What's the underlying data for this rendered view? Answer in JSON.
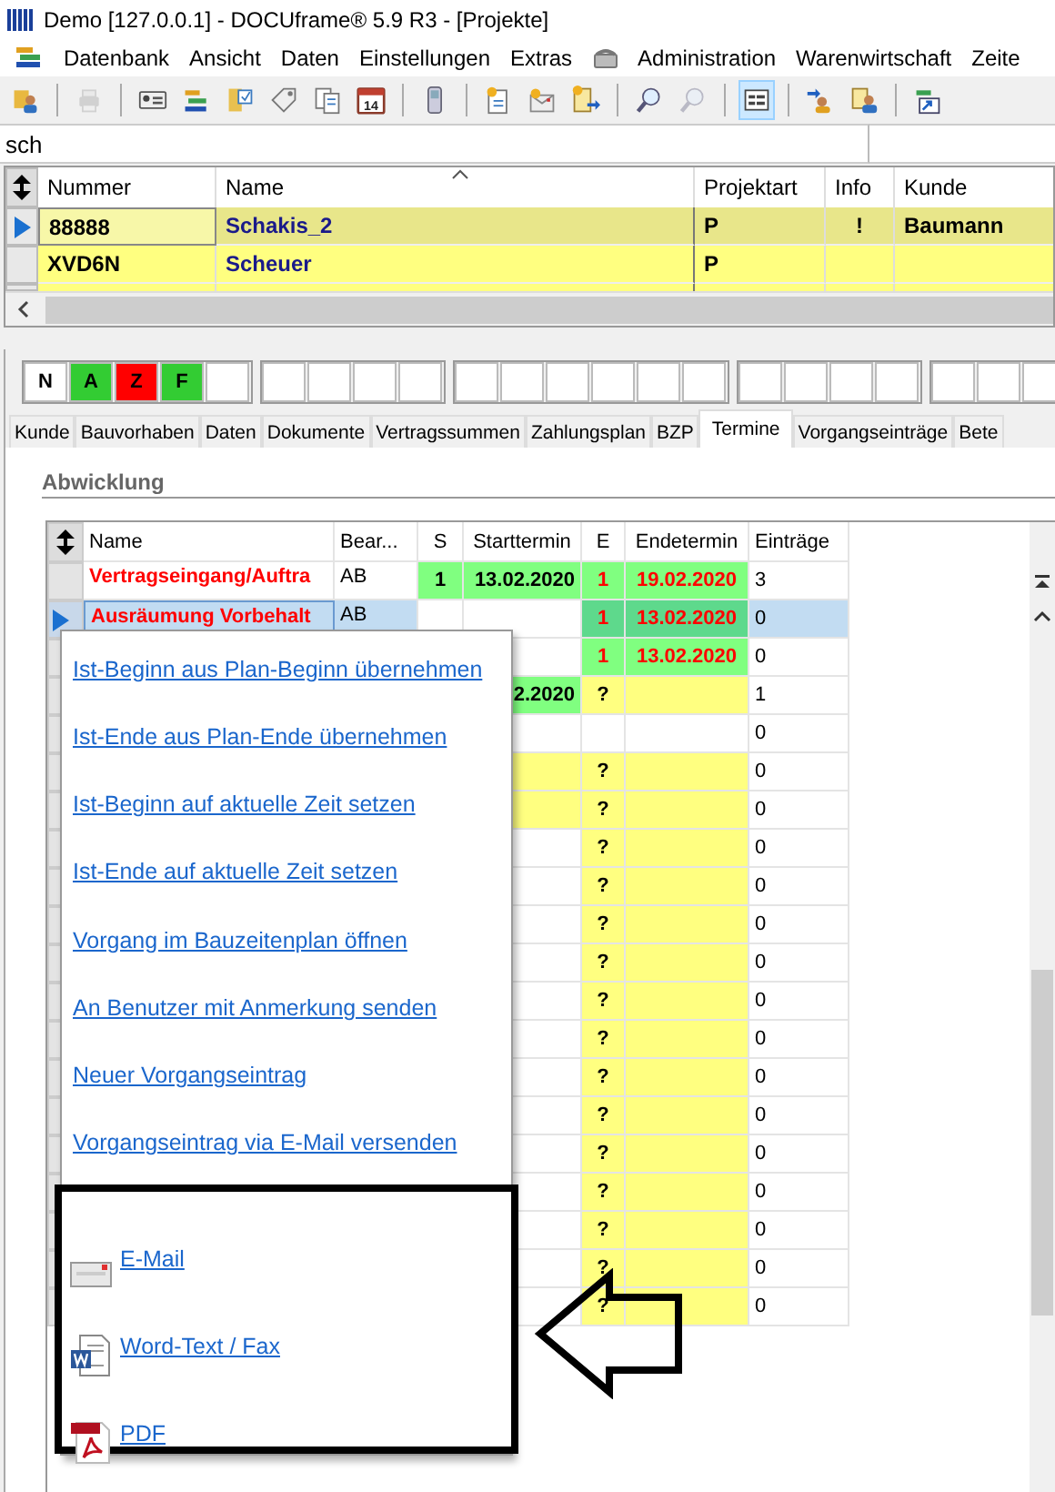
{
  "window": {
    "title": "Demo [127.0.0.1] - DOCUframe® 5.9 R3 - [Projekte]"
  },
  "menu": [
    {
      "label": "Datenbank",
      "kind": "text"
    },
    {
      "label": "Ansicht",
      "kind": "text"
    },
    {
      "label": "Daten",
      "kind": "text"
    },
    {
      "label": "Einstellungen",
      "kind": "text"
    },
    {
      "label": "Extras",
      "kind": "text"
    },
    {
      "label": "Administration",
      "kind": "phone"
    },
    {
      "label": "Warenwirtschaft",
      "kind": "text"
    },
    {
      "label": "Zeite",
      "kind": "text"
    }
  ],
  "toolbar": [
    [
      {
        "kind": "people",
        "disabled": false,
        "selected": false
      }
    ],
    [
      {
        "kind": "printer",
        "disabled": true,
        "selected": false
      }
    ],
    [
      {
        "kind": "card",
        "disabled": false,
        "selected": false
      },
      {
        "kind": "bars",
        "disabled": false,
        "selected": false
      },
      {
        "kind": "folder",
        "disabled": false,
        "selected": false
      },
      {
        "kind": "tag",
        "disabled": false,
        "selected": false
      },
      {
        "kind": "docs",
        "disabled": false,
        "selected": false
      },
      {
        "kind": "calendar",
        "label": "14",
        "disabled": false,
        "selected": false
      }
    ],
    [
      {
        "kind": "phone",
        "disabled": false,
        "selected": false
      }
    ],
    [
      {
        "kind": "docnew",
        "disabled": false,
        "selected": false
      },
      {
        "kind": "mailnew",
        "disabled": false,
        "selected": false
      },
      {
        "kind": "docarrow",
        "disabled": false,
        "selected": false
      }
    ],
    [
      {
        "kind": "search",
        "disabled": false,
        "selected": false
      },
      {
        "kind": "search",
        "disabled": true,
        "selected": false
      }
    ],
    [
      {
        "kind": "form",
        "disabled": false,
        "selected": true
      }
    ],
    [
      {
        "kind": "peoplearrow",
        "disabled": false,
        "selected": false
      },
      {
        "kind": "peopledoc",
        "disabled": false,
        "selected": false
      }
    ],
    [
      {
        "kind": "shortcut",
        "disabled": false,
        "selected": false
      }
    ]
  ],
  "search": {
    "value": "sch"
  },
  "projects": {
    "columns": [
      "Nummer",
      "Name",
      "Projektart",
      "Info",
      "Kunde"
    ],
    "rows": [
      {
        "number": "88888",
        "name": "Schakis_2",
        "type": "P",
        "info": "!",
        "customer": "Baumann",
        "selected": true
      },
      {
        "number": "XVD6N",
        "name": "Scheuer",
        "type": "P",
        "selected": false
      }
    ]
  },
  "status_groups": [
    [
      {
        "label": "N",
        "color": "#ffffff"
      },
      {
        "label": "A",
        "color": "#33cc33"
      },
      {
        "label": "Z",
        "color": "#ff0000"
      },
      {
        "label": "F",
        "color": "#33cc33"
      },
      {
        "color": "#ffffff"
      }
    ],
    [
      {
        "color": "#ffffff"
      },
      {
        "color": "#ffffff"
      },
      {
        "color": "#ffffff"
      },
      {
        "color": "#ffffff"
      }
    ],
    [
      {
        "color": "#ffffff"
      },
      {
        "color": "#ffffff"
      },
      {
        "color": "#ffffff"
      },
      {
        "color": "#ffffff"
      },
      {
        "color": "#ffffff"
      },
      {
        "color": "#ffffff"
      }
    ],
    [
      {
        "color": "#ffffff"
      },
      {
        "color": "#ffffff"
      },
      {
        "color": "#ffffff"
      },
      {
        "color": "#ffffff"
      }
    ],
    [
      {
        "color": "#ffffff"
      },
      {
        "color": "#ffffff"
      },
      {
        "color": "#ffffff"
      }
    ]
  ],
  "tabs": [
    {
      "label": "Kunde",
      "selected": false
    },
    {
      "label": "Bauvorhaben",
      "selected": false
    },
    {
      "label": "Daten",
      "selected": false
    },
    {
      "label": "Dokumente",
      "selected": false
    },
    {
      "label": "Vertragssummen",
      "selected": false
    },
    {
      "label": "Zahlungsplan",
      "selected": false
    },
    {
      "label": "BZP",
      "selected": false
    },
    {
      "label": "Termine",
      "selected": true
    },
    {
      "label": "Vorgangseinträge",
      "selected": false
    },
    {
      "label": "Bete",
      "selected": false
    }
  ],
  "section": "Abwicklung",
  "schedule": {
    "columns": [
      "Name",
      "Bear...",
      "S",
      "Starttermin",
      "E",
      "Endetermin",
      "Einträge"
    ],
    "rows": [
      {
        "name": "Vertragseingang/Auftra",
        "worker": "AB",
        "s": "1",
        "start": {
          "text": "13.02.2020",
          "color": "#80ff80"
        },
        "e": "1",
        "end": {
          "text": "19.02.2020",
          "color": "#80ff80"
        },
        "overdue": true,
        "entries": "3",
        "selected": false
      },
      {
        "name": "Ausräumung Vorbehalt",
        "worker": "AB",
        "e": "1",
        "end": {
          "text": "13.02.2020",
          "color": "#5ed98c"
        },
        "overdue": true,
        "entries": "0",
        "selected": true
      },
      {
        "e": "1",
        "end": {
          "text": "13.02.2020",
          "color": "#80ff80"
        },
        "overdue": true,
        "entries": "0",
        "selected": false
      },
      {
        "start": {
          "text": "2.2020",
          "color": "#80ff80"
        },
        "e": "?",
        "end": {
          "color": "#ffff80"
        },
        "overdue": false,
        "entries": "1",
        "selected": false
      },
      {
        "entries": "0",
        "selected": false
      },
      {
        "start": {
          "color": "#ffff80"
        },
        "e": "?",
        "end": {
          "color": "#ffff80"
        },
        "overdue": false,
        "entries": "0",
        "selected": false
      },
      {
        "start": {
          "color": "#ffff80"
        },
        "e": "?",
        "end": {
          "color": "#ffff80"
        },
        "overdue": false,
        "entries": "0",
        "selected": false
      },
      {
        "e": "?",
        "end": {
          "color": "#ffff80"
        },
        "overdue": false,
        "entries": "0",
        "selected": false
      },
      {
        "e": "?",
        "end": {
          "color": "#ffff80"
        },
        "overdue": false,
        "entries": "0",
        "selected": false
      },
      {
        "e": "?",
        "end": {
          "color": "#ffff80"
        },
        "overdue": false,
        "entries": "0",
        "selected": false
      },
      {
        "e": "?",
        "end": {
          "color": "#ffff80"
        },
        "overdue": false,
        "entries": "0",
        "selected": false
      },
      {
        "e": "?",
        "end": {
          "color": "#ffff80"
        },
        "overdue": false,
        "entries": "0",
        "selected": false
      },
      {
        "e": "?",
        "end": {
          "color": "#ffff80"
        },
        "overdue": false,
        "entries": "0",
        "selected": false
      },
      {
        "e": "?",
        "end": {
          "color": "#ffff80"
        },
        "overdue": false,
        "entries": "0",
        "selected": false
      },
      {
        "e": "?",
        "end": {
          "color": "#ffff80"
        },
        "overdue": false,
        "entries": "0",
        "selected": false
      },
      {
        "e": "?",
        "end": {
          "color": "#ffff80"
        },
        "overdue": false,
        "entries": "0",
        "selected": false
      },
      {
        "e": "?",
        "end": {
          "color": "#ffff80"
        },
        "overdue": false,
        "entries": "0",
        "selected": false
      },
      {
        "e": "?",
        "end": {
          "color": "#ffff80"
        },
        "overdue": false,
        "entries": "0",
        "selected": false
      },
      {
        "e": "?",
        "end": {
          "color": "#ffff80"
        },
        "overdue": false,
        "entries": "0",
        "selected": false
      },
      {
        "e": "?",
        "end": {
          "color": "#ffff80"
        },
        "overdue": false,
        "entries": "0",
        "selected": false
      }
    ]
  },
  "context_menu": {
    "items": [
      "Ist-Beginn aus Plan-Beginn übernehmen",
      "Ist-Ende aus Plan-Ende übernehmen",
      "Ist-Beginn auf aktuelle Zeit setzen",
      "Ist-Ende auf aktuelle Zeit setzen",
      "Vorgang im Bauzeitenplan öffnen",
      "An Benutzer mit Anmerkung senden",
      "Neuer Vorgangseintrag",
      "Vorgangseintrag via E-Mail versenden"
    ],
    "send_items": [
      {
        "label": "E-Mail",
        "kind": "mail"
      },
      {
        "label": "Word-Text / Fax",
        "kind": "word"
      },
      {
        "label": "PDF",
        "kind": "pdf"
      }
    ]
  }
}
